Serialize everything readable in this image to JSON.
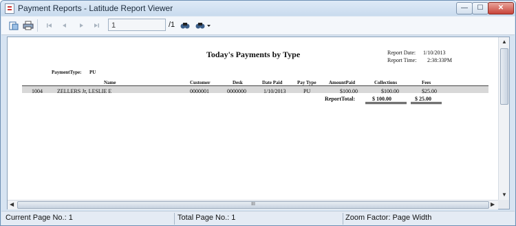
{
  "window": {
    "title": "Payment Reports - Latitude Report Viewer",
    "min_glyph": "—",
    "max_glyph": "☐",
    "close_glyph": "✕"
  },
  "toolbar": {
    "page_input": "1",
    "page_total": "/1",
    "icons": [
      "print-setup-icon",
      "print-icon",
      "first-page-icon",
      "prev-page-icon",
      "next-page-icon",
      "last-page-icon",
      "find-icon",
      "find-options-icon"
    ]
  },
  "report": {
    "title": "Today's Payments by Type",
    "report_date_label": "Report Date:",
    "report_date": "1/10/2013",
    "report_time_label": "Report Time:",
    "report_time": "2:38:33PM",
    "payment_type_label": "PaymentType:",
    "payment_type": "PU",
    "columns": [
      "Name",
      "Customer",
      "Desk",
      "Date Paid",
      "Pay Type",
      "AmountPaid",
      "Collections",
      "Fees"
    ],
    "row": {
      "id": "1004",
      "name": "ZELLERS Jr, LESLIE E",
      "customer": "0000001",
      "desk": "0000000",
      "date_paid": "1/10/2013",
      "pay_type": "PU",
      "amount_paid": "$100.00",
      "collections": "$100.00",
      "fees": "$25.00"
    },
    "total_label": "ReportTotal:",
    "total_collections": "$ 100.00",
    "total_fees": "$ 25.00"
  },
  "scroll": {
    "h_thumb_glyph": "III"
  },
  "status": {
    "current_page": "Current Page No.: 1",
    "total_page": "Total Page No.: 1",
    "zoom": "Zoom Factor: Page Width"
  }
}
